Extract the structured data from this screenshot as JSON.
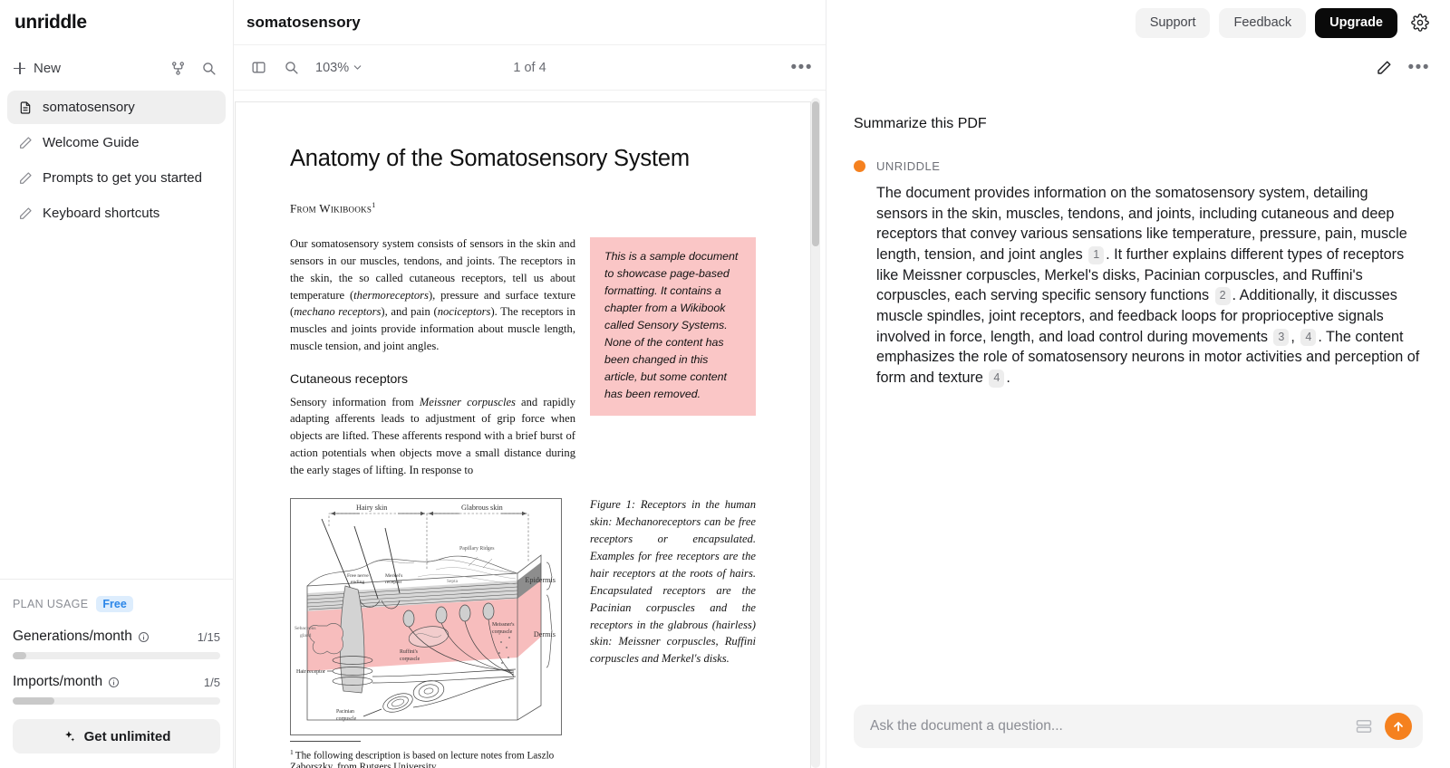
{
  "brand": "unriddle",
  "sidebar": {
    "new_label": "New",
    "organize_icon": "git-branch-icon",
    "search_icon": "search-icon",
    "items": [
      {
        "label": "somatosensory",
        "icon": "file-document-icon",
        "active": true
      },
      {
        "label": "Welcome Guide",
        "icon": "pencil-icon",
        "active": false
      },
      {
        "label": "Prompts to get you started",
        "icon": "pencil-icon",
        "active": false
      },
      {
        "label": "Keyboard shortcuts",
        "icon": "pencil-icon",
        "active": false
      }
    ],
    "plan": {
      "title": "PLAN USAGE",
      "badge": "Free",
      "badge_color": "#2b86e8",
      "meters": [
        {
          "name": "Generations/month",
          "value": "1/15",
          "percent": 6.7
        },
        {
          "name": "Imports/month",
          "value": "1/5",
          "percent": 20
        }
      ],
      "cta": "Get unlimited",
      "cta_icon": "sparkles-icon"
    }
  },
  "header": {
    "doc_title": "somatosensory",
    "support": "Support",
    "feedback": "Feedback",
    "upgrade": "Upgrade",
    "settings_icon": "gear-icon",
    "accent": "#f5811f"
  },
  "pdf_toolbar": {
    "sidebar_toggle_icon": "panel-left-icon",
    "search_icon": "search-icon",
    "zoom_level": "103%",
    "chevron_icon": "chevron-down-icon",
    "page_indicator": "1 of 4",
    "more_icon": "ellipsis-icon"
  },
  "document": {
    "title": "Anatomy of the Somatosensory System",
    "source": "From Wikibooks",
    "source_footnote_marker": "1",
    "paragraph_1_parts": [
      "Our somatosensory system consists of sensors in the skin and sensors in our muscles, tendons, and joints. The receptors in the skin, the so called cutaneous receptors, tell us about temperature (",
      "thermoreceptors",
      "), pressure and surface texture (",
      "mechano receptors",
      "), and pain (",
      "nociceptors",
      "). The receptors in muscles and joints provide information about muscle length, muscle tension, and joint angles."
    ],
    "note_box": "This is a sample document to showcase page-based formatting. It contains a chapter from a Wikibook called Sensory Systems. None of the content has been changed in this article, but some content has been removed.",
    "note_box_color": "#fac6c6",
    "section_heading": "Cutaneous receptors",
    "paragraph_2_parts": [
      "Sensory information from ",
      "Meissner corpuscles",
      " and rapidly adapting afferents leads to adjustment of grip force when objects are lifted. These afferents respond with a brief burst of action potentials when objects move a small distance during the early stages of lifting. In response to"
    ],
    "figure_caption": "Figure 1:  Receptors in the human skin: Mechanoreceptors can be free receptors or encapsulated. Examples for free receptors are the hair receptors at the roots of hairs. Encapsulated receptors are the Pacinian corpuscles and the receptors in the glabrous (hairless) skin: Meissner corpuscles, Ruffini corpuscles and Merkel's disks.",
    "figure_labels": {
      "hairy_skin": "Hairy skin",
      "glabrous_skin": "Glabrous skin",
      "papillary_ridges": "Papillary Ridges",
      "septa": "Septa",
      "epidermis": "Epidermis",
      "dermis": "Dermis",
      "free_nerve_ending": "Free nerve ending",
      "merkels_receptor": "Merkel's receptor",
      "sebaceous_gland": "Sebaceous gland",
      "hair_receptor": "Hair receptor",
      "pacinian_corpuscle": "Pacinian corpuscle",
      "ruffinis_corpuscle": "Ruffini's corpuscle",
      "meissners_corpuscle": "Meissner's corpuscle"
    },
    "footnote_marker": "1",
    "footnote": "The following description is based on lecture notes from Laszlo Zaborszky, from Rutgers University."
  },
  "chat": {
    "edit_icon": "pencil-icon",
    "more_icon": "ellipsis-icon",
    "user_message": "Summarize this PDF",
    "bot_name": "UNRIDDLE",
    "bot_dot_color": "#f5811f",
    "answer_parts": [
      {
        "type": "text",
        "value": "The document provides information on the somatosensory system, detailing sensors in the skin, muscles, tendons, and joints, including cutaneous and deep receptors that convey various sensations like temperature, pressure, pain, muscle length, tension, and joint angles "
      },
      {
        "type": "cite",
        "value": "1"
      },
      {
        "type": "text",
        "value": ". It further explains different types of receptors like Meissner corpuscles, Merkel's disks, Pacinian corpuscles, and Ruffini's corpuscles, each serving specific sensory functions "
      },
      {
        "type": "cite",
        "value": "2"
      },
      {
        "type": "text",
        "value": ". Additionally, it discusses muscle spindles, joint receptors, and feedback loops for proprioceptive signals involved in force, length, and load control during movements "
      },
      {
        "type": "cite",
        "value": "3"
      },
      {
        "type": "text",
        "value": ", "
      },
      {
        "type": "cite",
        "value": "4"
      },
      {
        "type": "text",
        "value": ". The content emphasizes the role of somatosensory neurons in motor activities and perception of form and texture "
      },
      {
        "type": "cite",
        "value": "4"
      },
      {
        "type": "text",
        "value": "."
      }
    ],
    "input_placeholder": "Ask the document a question...",
    "cards_icon": "cards-icon",
    "send_icon": "arrow-up-icon"
  }
}
